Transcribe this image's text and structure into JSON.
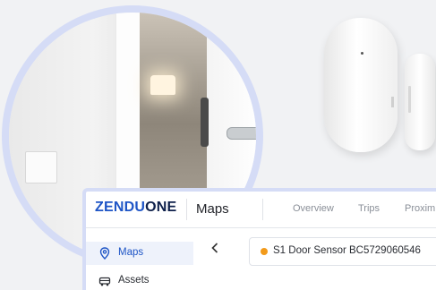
{
  "brand": {
    "logo_part1": "ZENDU",
    "logo_part2": "ONE",
    "accent": "#1e55c6",
    "dark": "#0d1f4a"
  },
  "header": {
    "title": "Maps",
    "tabs": [
      {
        "label": "Overview"
      },
      {
        "label": "Trips"
      },
      {
        "label": "Proxim"
      }
    ]
  },
  "sidebar": {
    "items": [
      {
        "label": "Maps",
        "icon": "map-pin-icon",
        "active": true
      },
      {
        "label": "Assets",
        "icon": "truck-icon",
        "active": false
      }
    ]
  },
  "device": {
    "name": "S1 Door Sensor BC5729060546",
    "status_color": "#f29a1a"
  },
  "icons": {
    "back": "chevron-left-icon"
  },
  "decor": {
    "ring_color": "#d5dcf6"
  }
}
